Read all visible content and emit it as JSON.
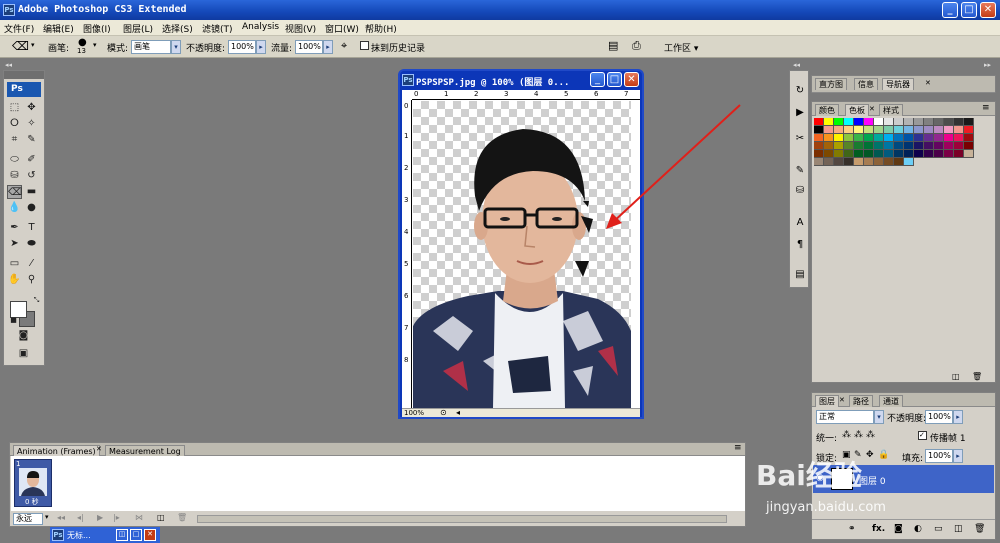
{
  "window": {
    "title": "Adobe Photoshop CS3 Extended",
    "app_icon": "Ps"
  },
  "menu": [
    "文件(F)",
    "编辑(E)",
    "图像(I)",
    "图层(L)",
    "选择(S)",
    "滤镜(T)",
    "Analysis",
    "视图(V)",
    "窗口(W)",
    "帮助(H)"
  ],
  "options": {
    "brush_label": "画笔:",
    "brush_size": "13",
    "mode_label": "模式:",
    "mode_value": "画笔",
    "opacity_label": "不透明度:",
    "opacity_value": "100%",
    "flow_label": "流量:",
    "flow_value": "100%",
    "erase_history_label": "抹到历史记录",
    "workspace_label": "工作区 ▾"
  },
  "toolbox": {
    "logo": "Ps"
  },
  "document": {
    "title": "PSPSPSP.jpg @ 100% (图层 0...",
    "zoom": "100%",
    "ruler_h": [
      "0",
      "1",
      "2",
      "3",
      "4",
      "5",
      "6",
      "7"
    ],
    "ruler_v": [
      "0",
      "1",
      "2",
      "3",
      "4",
      "5",
      "6",
      "7",
      "8"
    ]
  },
  "panels": {
    "top_tabs": [
      "直方图",
      "信息",
      "导航器"
    ],
    "swatch_tabs": [
      "颜色",
      "色板",
      "样式"
    ],
    "layer_tabs": [
      "图层",
      "路径",
      "通道"
    ],
    "blend_mode": "正常",
    "opacity_label": "不透明度:",
    "opacity_value": "100%",
    "unify_label": "统一:",
    "propagate_label": "传播帧 1",
    "lock_label": "锁定:",
    "fill_label": "填充:",
    "fill_value": "100%",
    "layer_name": "图层 0"
  },
  "animation": {
    "tabs": [
      "Animation (Frames)",
      "Measurement Log"
    ],
    "frame_number": "1",
    "frame_delay": "0 秒",
    "loop": "永远"
  },
  "taskbar": {
    "minimized": "无标..."
  },
  "watermark": {
    "brand": "Bai经验",
    "url": "jingyan.baidu.com"
  },
  "colors": {
    "titlebar": "#1448b8",
    "arrow": "#e0201a",
    "layer_selected": "#3e64c8",
    "swatches": [
      "#ff0000",
      "#ffff00",
      "#00ff00",
      "#00ffff",
      "#0000ff",
      "#ff00ff",
      "#ffffff",
      "#e6e6e6",
      "#cccccc",
      "#b3b3b3",
      "#999999",
      "#808080",
      "#666666",
      "#4d4d4d",
      "#333333",
      "#1a1a1a",
      "#000000",
      "#f5998b",
      "#f7ac7f",
      "#fcd080",
      "#fff57e",
      "#c8e07e",
      "#a1d48b",
      "#7dcba8",
      "#6ccfda",
      "#74b5e4",
      "#8c97cd",
      "#9e8bc3",
      "#bd8ac1",
      "#f39ac3",
      "#f4998f",
      "#ed1c24",
      "#f26522",
      "#f7941d",
      "#fff200",
      "#8dc63f",
      "#39b54a",
      "#00a651",
      "#00a99d",
      "#00aeef",
      "#0072bc",
      "#0054a6",
      "#2e3192",
      "#662d91",
      "#92278f",
      "#ec008c",
      "#ed145b",
      "#9e0b0f",
      "#a0410d",
      "#a36209",
      "#aba000",
      "#598527",
      "#197b30",
      "#007236",
      "#00746b",
      "#0076a3",
      "#004a80",
      "#003471",
      "#1b1464",
      "#440e62",
      "#630460",
      "#9e005d",
      "#9e0039",
      "#790000",
      "#7b2e00",
      "#7d4900",
      "#827b00",
      "#406618",
      "#005e20",
      "#005826",
      "#005952",
      "#005b7f",
      "#003663",
      "#002157",
      "#0d004c",
      "#32004b",
      "#4b0049",
      "#7b0046",
      "#7a0026",
      "#c7b299",
      "#998675",
      "#736357",
      "#534741",
      "#37302a",
      "#c69c6d",
      "#a67c52",
      "#8c6239",
      "#754c24",
      "#603913",
      "#6dcff6"
    ]
  }
}
